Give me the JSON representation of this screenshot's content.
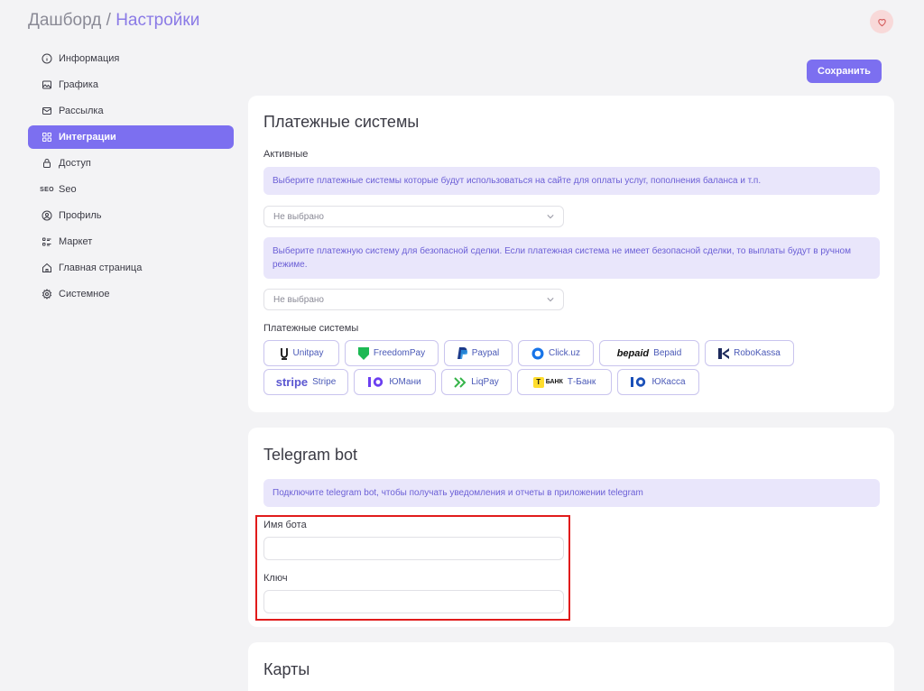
{
  "breadcrumb": {
    "root": "Дашборд",
    "separator": "/",
    "current": "Настройки"
  },
  "header": {
    "favorite_icon": "heart-icon",
    "save_label": "Сохранить"
  },
  "sidebar": {
    "items": [
      {
        "label": "Информация",
        "icon": "info-icon"
      },
      {
        "label": "Графика",
        "icon": "image-icon"
      },
      {
        "label": "Рассылка",
        "icon": "mail-icon"
      },
      {
        "label": "Интеграции",
        "icon": "grid-icon",
        "active": true
      },
      {
        "label": "Доступ",
        "icon": "lock-icon"
      },
      {
        "label": "Seo",
        "icon": "seo-icon",
        "icon_text": "SEO"
      },
      {
        "label": "Профиль",
        "icon": "user-icon"
      },
      {
        "label": "Маркет",
        "icon": "list-icon"
      },
      {
        "label": "Главная страница",
        "icon": "home-icon"
      },
      {
        "label": "Системное",
        "icon": "gear-icon"
      }
    ]
  },
  "payments": {
    "title": "Платежные системы",
    "active_label": "Активные",
    "note1": "Выберите платежные системы которые будут использоваться на сайте для оплаты услуг, пополнения баланса и т.п.",
    "select1": "Не выбрано",
    "note2": "Выберите платежную систему для безопасной сделки. Если платежная система не имеет безопасной сделки, то выплаты будут в ручном режиме.",
    "select2": "Не выбрано",
    "systems_label": "Платежные системы",
    "row1": [
      {
        "label": "Unitpay",
        "icon": "unitpay-logo"
      },
      {
        "label": "FreedomPay",
        "icon": "freedompay-logo"
      },
      {
        "label": "Paypal",
        "icon": "paypal-logo"
      },
      {
        "label": "Click.uz",
        "icon": "clickuz-logo"
      },
      {
        "label": "Bepaid",
        "icon": "bepaid-logo",
        "logo_text": "bepaid"
      },
      {
        "label": "RoboKassa",
        "icon": "robokassa-logo"
      }
    ],
    "row2": [
      {
        "label": "Stripe",
        "icon": "stripe-logo",
        "logo_text": "stripe"
      },
      {
        "label": "ЮМани",
        "icon": "yumoney-logo"
      },
      {
        "label": "LiqPay",
        "icon": "liqpay-logo"
      },
      {
        "label": "Т-Банк",
        "icon": "tbank-logo",
        "logo_text": "БАНК"
      },
      {
        "label": "ЮКасса",
        "icon": "yukassa-logo"
      }
    ]
  },
  "telegram": {
    "title": "Telegram bot",
    "note": "Подключите telegram bot, чтобы получать уведомления и отчеты в приложении telegram",
    "bot_name_label": "Имя бота",
    "bot_name_value": "",
    "key_label": "Ключ",
    "key_value": ""
  },
  "maps": {
    "title": "Карты"
  },
  "colors": {
    "accent": "#7c6ff0",
    "note_bg": "#e9e6fb",
    "note_text": "#6b5fd6",
    "highlight": "#e11b1b"
  }
}
